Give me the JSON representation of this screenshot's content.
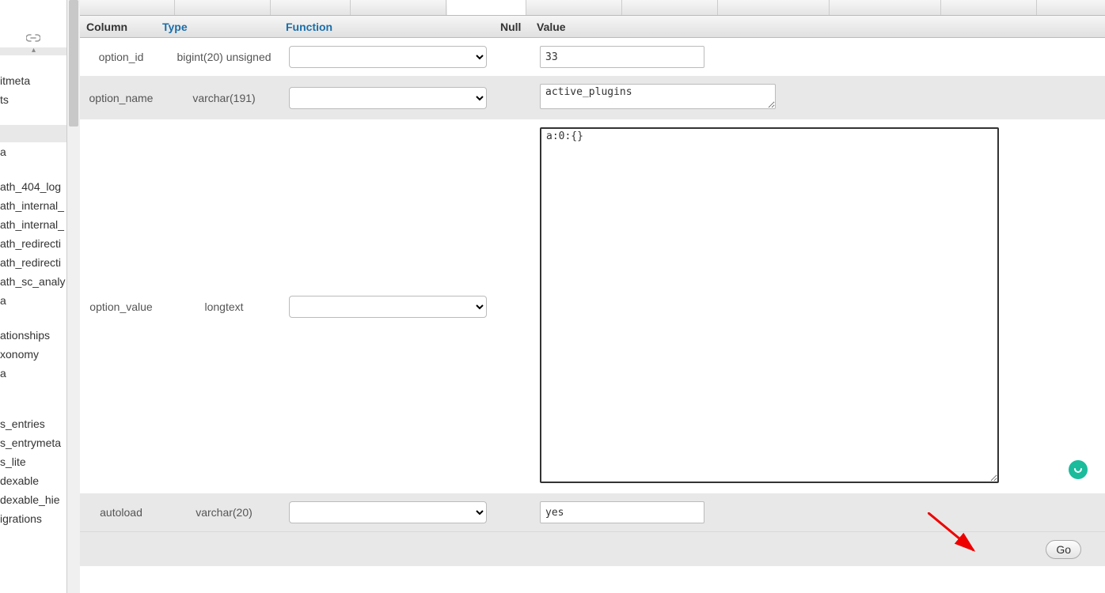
{
  "headers": {
    "column": "Column",
    "type": "Type",
    "function": "Function",
    "null": "Null",
    "value": "Value"
  },
  "rows": [
    {
      "column": "option_id",
      "type": "bigint(20) unsigned",
      "value": "33",
      "kind": "input",
      "alt": false
    },
    {
      "column": "option_name",
      "type": "varchar(191)",
      "value": "active_plugins",
      "kind": "textarea_sm",
      "alt": true
    },
    {
      "column": "option_value",
      "type": "longtext",
      "value": "a:0:{}",
      "kind": "textarea_lg",
      "alt": false
    },
    {
      "column": "autoload",
      "type": "varchar(20)",
      "value": "yes",
      "kind": "input",
      "alt": true
    }
  ],
  "go_label": "Go",
  "sidebar": {
    "items_top": [
      "itmeta",
      "ts"
    ],
    "items_mid": [
      "a",
      "",
      "ath_404_log",
      "ath_internal_",
      "ath_internal_",
      "ath_redirecti",
      "ath_redirecti",
      "ath_sc_analy",
      "a",
      "",
      "ationships",
      "xonomy",
      "a",
      "",
      "",
      "s_entries",
      "s_entrymeta",
      "s_lite",
      "dexable",
      "dexable_hie",
      "igrations"
    ]
  }
}
